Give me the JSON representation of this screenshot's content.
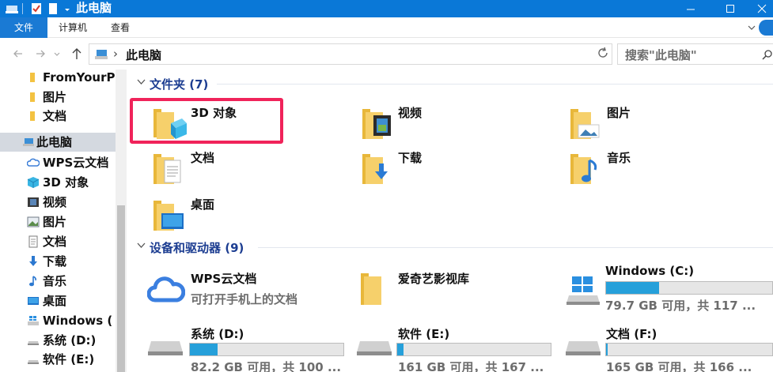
{
  "window": {
    "title": "此电脑"
  },
  "ribbon": {
    "tabs": [
      "文件",
      "计算机",
      "查看"
    ]
  },
  "address": {
    "location": "此电脑",
    "search_placeholder": "搜索\"此电脑\""
  },
  "nav": {
    "items": [
      {
        "label": "FromYourP",
        "icon": "folder-icon"
      },
      {
        "label": "图片",
        "icon": "folder-icon"
      },
      {
        "label": "文档",
        "icon": "folder-icon"
      },
      {
        "label": "此电脑",
        "icon": "pc-icon"
      },
      {
        "label": "WPS云文档",
        "icon": "cloud-icon"
      },
      {
        "label": "3D 对象",
        "icon": "3d-objects-icon"
      },
      {
        "label": "视频",
        "icon": "video-icon"
      },
      {
        "label": "图片",
        "icon": "pictures-icon"
      },
      {
        "label": "文档",
        "icon": "documents-icon"
      },
      {
        "label": "下载",
        "icon": "download-icon"
      },
      {
        "label": "音乐",
        "icon": "music-icon"
      },
      {
        "label": "桌面",
        "icon": "desktop-icon"
      },
      {
        "label": "Windows (",
        "icon": "windows-drive-icon"
      },
      {
        "label": "系统 (D:)",
        "icon": "drive-icon"
      },
      {
        "label": "软件 (E:)",
        "icon": "drive-icon"
      }
    ]
  },
  "folders": {
    "title": "文件夹 (7)",
    "items": [
      {
        "label": "3D 对象",
        "icon": "3d-objects-folder-icon"
      },
      {
        "label": "视频",
        "icon": "video-folder-icon"
      },
      {
        "label": "图片",
        "icon": "pictures-folder-icon"
      },
      {
        "label": "文档",
        "icon": "documents-folder-icon"
      },
      {
        "label": "下载",
        "icon": "downloads-folder-icon"
      },
      {
        "label": "音乐",
        "icon": "music-folder-icon"
      },
      {
        "label": "桌面",
        "icon": "desktop-folder-icon"
      }
    ]
  },
  "devices": {
    "title": "设备和驱动器 (9)",
    "wps": {
      "name": "WPS云文档",
      "sub": "可打开手机上的文档"
    },
    "iqiyi": {
      "name": "爱奇艺影视库"
    },
    "drives": [
      {
        "name": "Windows (C:)",
        "free": "79.7 GB 可用，共 117 ...",
        "used_fraction": 0.32
      },
      {
        "name": "系统 (D:)",
        "free": "82.2 GB 可用，共 100 ...",
        "used_fraction": 0.18
      },
      {
        "name": "软件 (E:)",
        "free": "161 GB 可用，共 167 ...",
        "used_fraction": 0.04
      },
      {
        "name": "文档 (F:)",
        "free": "165 GB 可用，共 166 ...",
        "used_fraction": 0.01
      }
    ]
  },
  "colors": {
    "titlebar": "#0a78d7",
    "accent": "#1a7ad4",
    "group_title": "#1c3d91",
    "highlight": "#f0235a",
    "drive_fill": "#26a0da"
  }
}
